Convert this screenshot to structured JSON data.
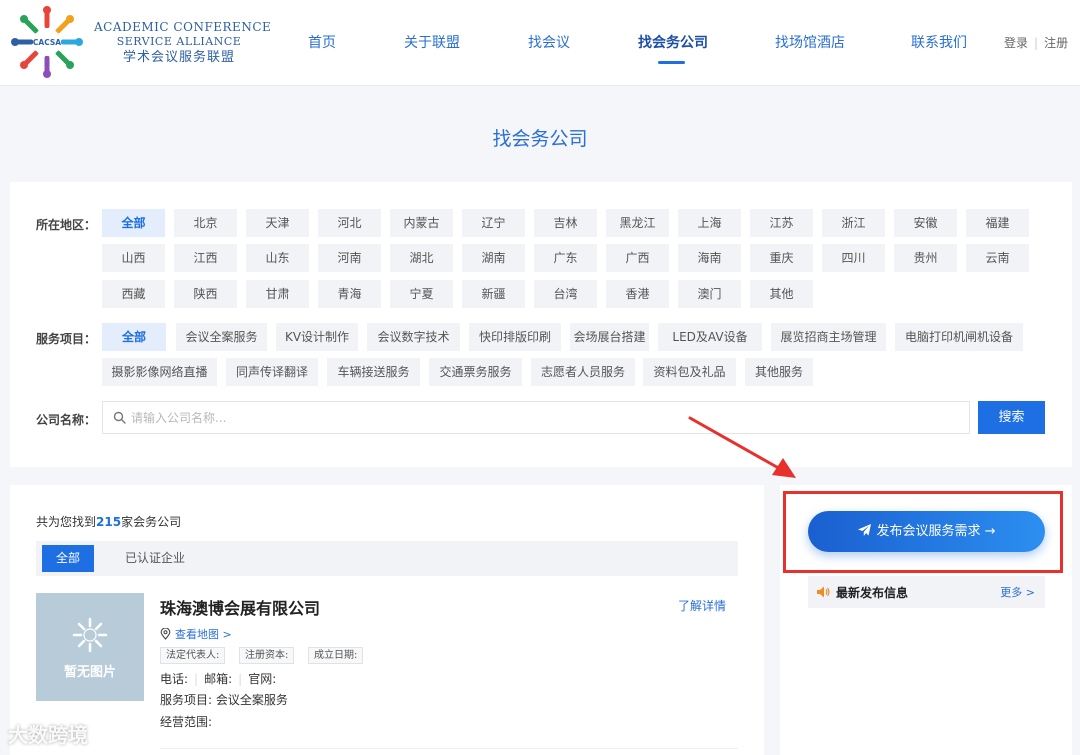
{
  "logo": {
    "badge": "CACSA",
    "en_line1": "ACADEMIC CONFERENCE",
    "en_line2": "SERVICE ALLIANCE",
    "cn": "学术会议服务联盟"
  },
  "nav": {
    "items": [
      {
        "label": "首页"
      },
      {
        "label": "关于联盟"
      },
      {
        "label": "找会议"
      },
      {
        "label": "找会务公司"
      },
      {
        "label": "找场馆酒店"
      },
      {
        "label": "联系我们"
      }
    ],
    "login": "登录",
    "register": "注册"
  },
  "page_title": "找会务公司",
  "filter": {
    "region_label": "所在地区：",
    "regions": [
      "全部",
      "北京",
      "天津",
      "河北",
      "内蒙古",
      "辽宁",
      "吉林",
      "黑龙江",
      "上海",
      "江苏",
      "浙江",
      "安徽",
      "福建",
      "山西",
      "江西",
      "山东",
      "河南",
      "湖北",
      "湖南",
      "广东",
      "广西",
      "海南",
      "重庆",
      "四川",
      "贵州",
      "云南",
      "西藏",
      "陕西",
      "甘肃",
      "青海",
      "宁夏",
      "新疆",
      "台湾",
      "香港",
      "澳门",
      "其他"
    ],
    "service_label": "服务项目：",
    "services": [
      "全部",
      "会议全案服务",
      "KV设计制作",
      "会议数字技术",
      "快印排版印刷",
      "会场展台搭建",
      "LED及AV设备",
      "展览招商主场管理",
      "电脑打印机闸机设备",
      "摄影影像网络直播",
      "同声传译翻译",
      "车辆接送服务",
      "交通票务服务",
      "志愿者人员服务",
      "资料包及礼品",
      "其他服务"
    ],
    "company_label": "公司名称：",
    "search_placeholder": "请输入公司名称...",
    "search_button": "搜索"
  },
  "results": {
    "count_prefix": "共为您找到",
    "count": "215",
    "count_suffix": "家会务公司",
    "tabs": [
      "全部",
      "已认证企业"
    ],
    "company": {
      "no_image": "暂无图片",
      "name": "珠海澳博会展有限公司",
      "detail_link": "了解详情",
      "map_link": "查看地图 >",
      "chips": [
        "法定代表人:",
        "注册资本:",
        "成立日期:"
      ],
      "phone": "电话:",
      "email": "邮箱:",
      "website": "官网:",
      "services": "服务项目: 会议全案服务",
      "scope": "经营范围:"
    }
  },
  "side": {
    "publish_button": "发布会议服务需求 →",
    "latest_title": "最新发布信息",
    "latest_more": "更多 >"
  },
  "watermark": "大数跨境",
  "colors": {
    "accent": "#1d6fe3",
    "nav_text": "#2a6fd6",
    "annotation": "#e8302c"
  }
}
